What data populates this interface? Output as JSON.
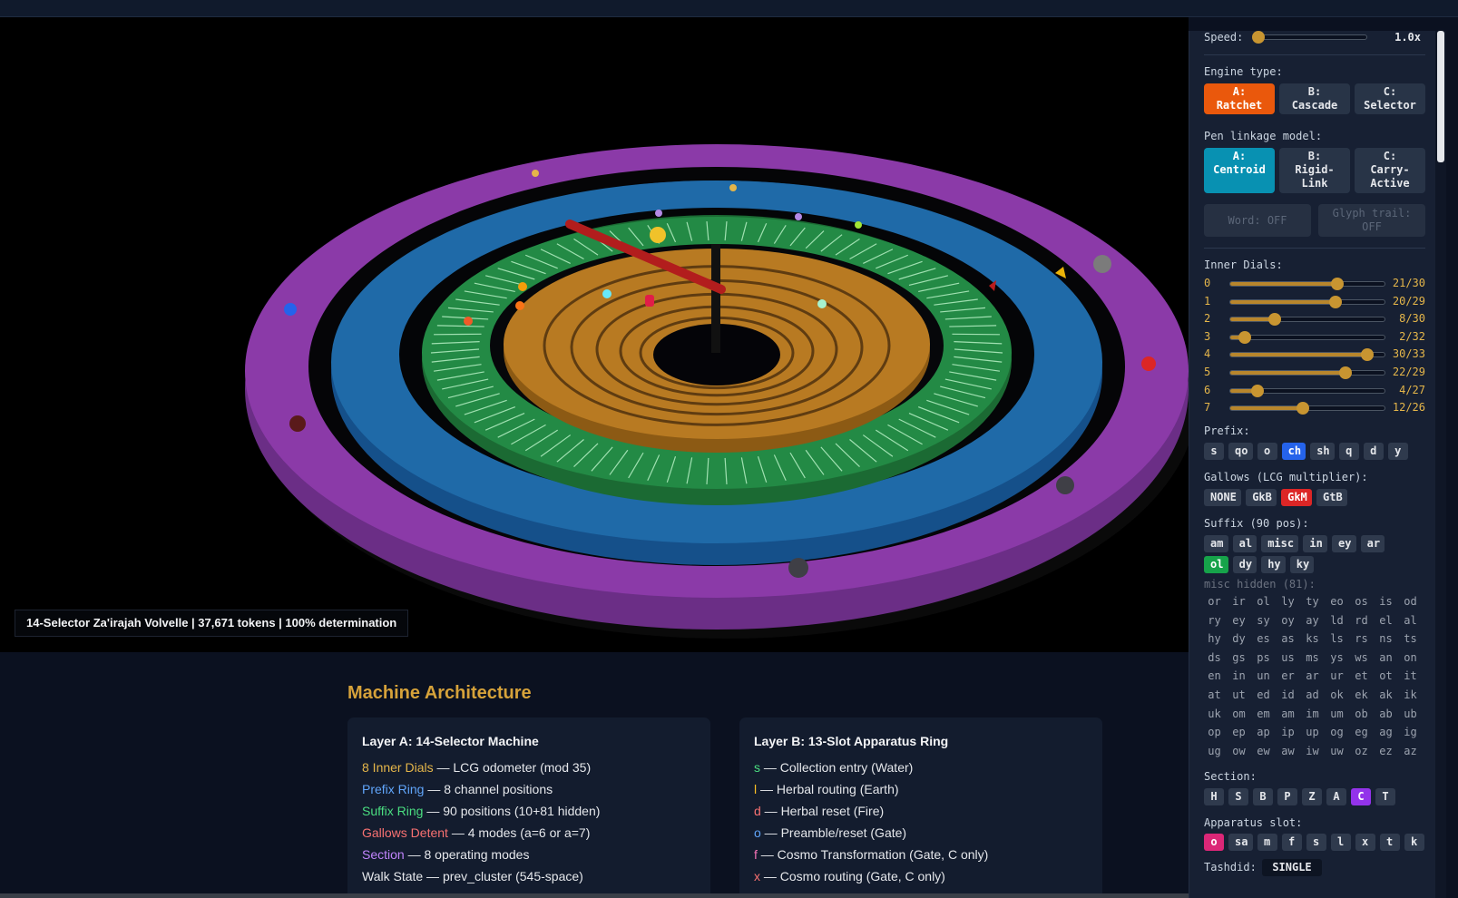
{
  "viewport": {
    "caption": "14-Selector Za'irajah Volvelle | 37,671 tokens | 100% determination"
  },
  "architecture": {
    "title": "Machine Architecture",
    "layer_a": {
      "title": "Layer A: 14-Selector Machine",
      "rows": [
        {
          "key": "8 Inner Dials",
          "desc": " — LCG odometer (mod 35)",
          "color": "#e5b64a"
        },
        {
          "key": "Prefix Ring",
          "desc": " — 8 channel positions",
          "color": "#60a5fa"
        },
        {
          "key": "Suffix Ring",
          "desc": " — 90 positions (10+81 hidden)",
          "color": "#4ade80"
        },
        {
          "key": "Gallows Detent",
          "desc": " — 4 modes (a=6 or a=7)",
          "color": "#f87171"
        },
        {
          "key": "Section",
          "desc": " — 8 operating modes",
          "color": "#c084fc"
        },
        {
          "key": "",
          "desc": "Walk State — prev_cluster (545-space)",
          "color": "#e5e7eb"
        }
      ]
    },
    "layer_b": {
      "title": "Layer B: 13-Slot Apparatus Ring",
      "rows": [
        {
          "key": "s",
          "desc": " — Collection entry (Water)",
          "color": "#4ade80"
        },
        {
          "key": "l",
          "desc": " — Herbal routing (Earth)",
          "color": "#fbbf24"
        },
        {
          "key": "d",
          "desc": " — Herbal reset (Fire)",
          "color": "#f87171"
        },
        {
          "key": "o",
          "desc": " — Preamble/reset (Gate)",
          "color": "#60a5fa"
        },
        {
          "key": "f",
          "desc": " — Cosmo Transformation (Gate, C only)",
          "color": "#f472b6"
        },
        {
          "key": "x",
          "desc": " — Cosmo routing (Gate, C only)",
          "color": "#f87171"
        }
      ]
    }
  },
  "panel": {
    "speed": {
      "label": "Speed:",
      "value": "1.0x",
      "level": 0.0
    },
    "engine": {
      "label": "Engine type:",
      "options": [
        {
          "line1": "A:",
          "line2": "Ratchet",
          "active": true
        },
        {
          "line1": "B:",
          "line2": "Cascade",
          "active": false
        },
        {
          "line1": "C:",
          "line2": "Selector",
          "active": false
        }
      ]
    },
    "pen": {
      "label": "Pen linkage model:",
      "options": [
        {
          "line1": "A:",
          "line2": "Centroid",
          "line3": "",
          "active": true
        },
        {
          "line1": "B:",
          "line2": "Rigid-",
          "line3": "Link",
          "active": false
        },
        {
          "line1": "C:",
          "line2": "Carry-",
          "line3": "Active",
          "active": false
        }
      ]
    },
    "word_toggle": "Word: OFF",
    "glyph_toggle_1": "Glyph trail:",
    "glyph_toggle_2": "OFF",
    "inner_dials": {
      "label": "Inner Dials:",
      "dials": [
        {
          "idx": "0",
          "value": "21/30",
          "pos": 21,
          "max": 30
        },
        {
          "idx": "1",
          "value": "20/29",
          "pos": 20,
          "max": 29
        },
        {
          "idx": "2",
          "value": "8/30",
          "pos": 8,
          "max": 30
        },
        {
          "idx": "3",
          "value": "2/32",
          "pos": 2,
          "max": 32
        },
        {
          "idx": "4",
          "value": "30/33",
          "pos": 30,
          "max": 33
        },
        {
          "idx": "5",
          "value": "22/29",
          "pos": 22,
          "max": 29
        },
        {
          "idx": "6",
          "value": "4/27",
          "pos": 4,
          "max": 27
        },
        {
          "idx": "7",
          "value": "12/26",
          "pos": 12,
          "max": 26
        }
      ]
    },
    "prefix": {
      "label": "Prefix:",
      "items": [
        "s",
        "qo",
        "o",
        "ch",
        "sh",
        "q",
        "d",
        "y"
      ],
      "active": "ch"
    },
    "gallows": {
      "label": "Gallows (LCG multiplier):",
      "items": [
        "NONE",
        "GkB",
        "GkM",
        "GtB"
      ],
      "active": "GkM"
    },
    "suffix": {
      "label": "Suffix (90 pos):",
      "row1": [
        "am",
        "al",
        "misc",
        "in",
        "ey",
        "ar"
      ],
      "row2": [
        "ol",
        "dy",
        "hy",
        "ky"
      ],
      "active": "ol"
    },
    "misc_hidden": {
      "label": "misc hidden (81):",
      "items": [
        "or",
        "ir",
        "ol",
        "ly",
        "ty",
        "eo",
        "os",
        "is",
        "od",
        "ry",
        "ey",
        "sy",
        "oy",
        "ay",
        "ld",
        "rd",
        "el",
        "al",
        "hy",
        "dy",
        "es",
        "as",
        "ks",
        "ls",
        "rs",
        "ns",
        "ts",
        "ds",
        "gs",
        "ps",
        "us",
        "ms",
        "ys",
        "ws",
        "an",
        "on",
        "en",
        "in",
        "un",
        "er",
        "ar",
        "ur",
        "et",
        "ot",
        "it",
        "at",
        "ut",
        "ed",
        "id",
        "ad",
        "ok",
        "ek",
        "ak",
        "ik",
        "uk",
        "om",
        "em",
        "am",
        "im",
        "um",
        "ob",
        "ab",
        "ub",
        "op",
        "ep",
        "ap",
        "ip",
        "up",
        "og",
        "eg",
        "ag",
        "ig",
        "ug",
        "ow",
        "ew",
        "aw",
        "iw",
        "uw",
        "oz",
        "ez",
        "az"
      ]
    },
    "section": {
      "label": "Section:",
      "items": [
        "H",
        "S",
        "B",
        "P",
        "Z",
        "A",
        "C",
        "T"
      ],
      "active": "C"
    },
    "apparatus": {
      "label": "Apparatus slot:",
      "items": [
        "o",
        "sa",
        "m",
        "f",
        "s",
        "l",
        "x",
        "t",
        "k"
      ],
      "active": "o"
    },
    "tashdid": {
      "label": "Tashdid:",
      "value": "SINGLE"
    }
  }
}
